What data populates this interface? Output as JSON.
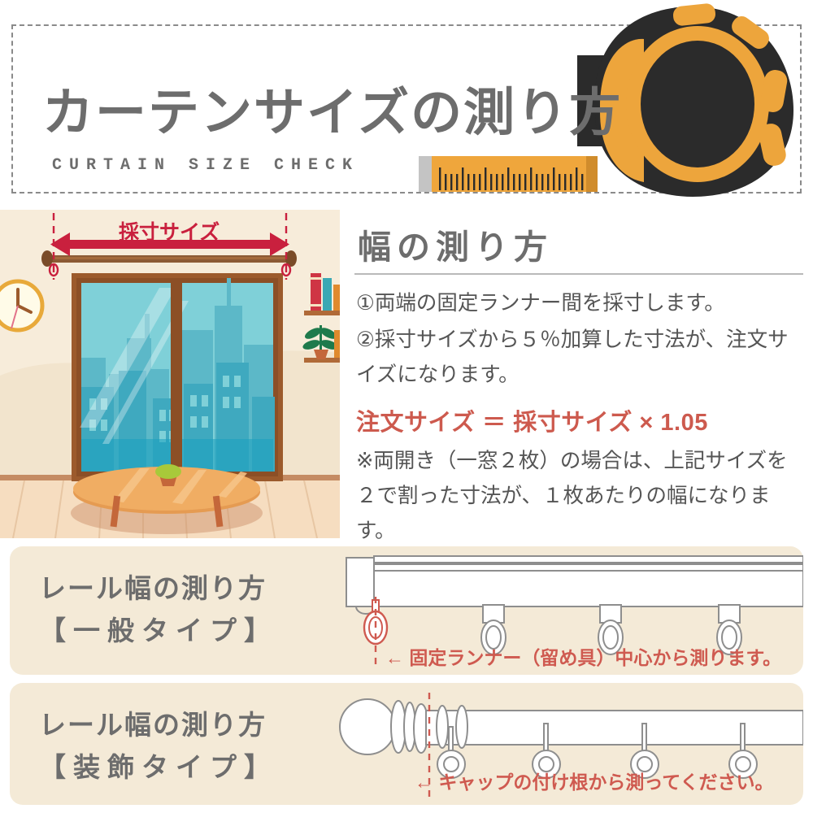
{
  "header": {
    "title": "カーテンサイズの測り方",
    "subtitle": "CURTAIN SIZE CHECK",
    "icon": "tape-measure-icon",
    "colors": {
      "body": "#2b2b2b",
      "accent": "#eda53c",
      "tape": "#efa63c"
    }
  },
  "room": {
    "measure_label": "採寸サイズ",
    "label_color": "#c9203e",
    "scene_items": [
      "wall-clock-icon",
      "bookshelf-icon",
      "potted-plant-icon",
      "window-icon",
      "curtain-rail-icon",
      "low-table-icon"
    ]
  },
  "width_section": {
    "heading": "幅の測り方",
    "steps": [
      "①両端の固定ランナー間を採寸します。",
      "②採寸サイズから５％加算した寸法が、注文サイズになります。"
    ],
    "formula": "注文サイズ ＝ 採寸サイズ × 1.05",
    "formula_color": "#cd5a4e",
    "note": "※両開き（一窓２枚）の場合は、上記サイズを２で割った寸法が、１枚あたりの幅になります。"
  },
  "rail_sections": [
    {
      "title_line1": "レール幅の測り方",
      "title_line2": "【一般タイプ】",
      "note": "← 固定ランナー（留め具）中心から測ります。",
      "note_color": "#cf5a50",
      "illustration": "general-curtain-rail-icon",
      "panel_color": "#f4ead7"
    },
    {
      "title_line1": "レール幅の測り方",
      "title_line2": "【装飾タイプ】",
      "note": "← キャップの付け根から測ってください。",
      "note_color": "#cf5a50",
      "illustration": "decorative-curtain-rod-icon",
      "panel_color": "#f4ead7"
    }
  ]
}
